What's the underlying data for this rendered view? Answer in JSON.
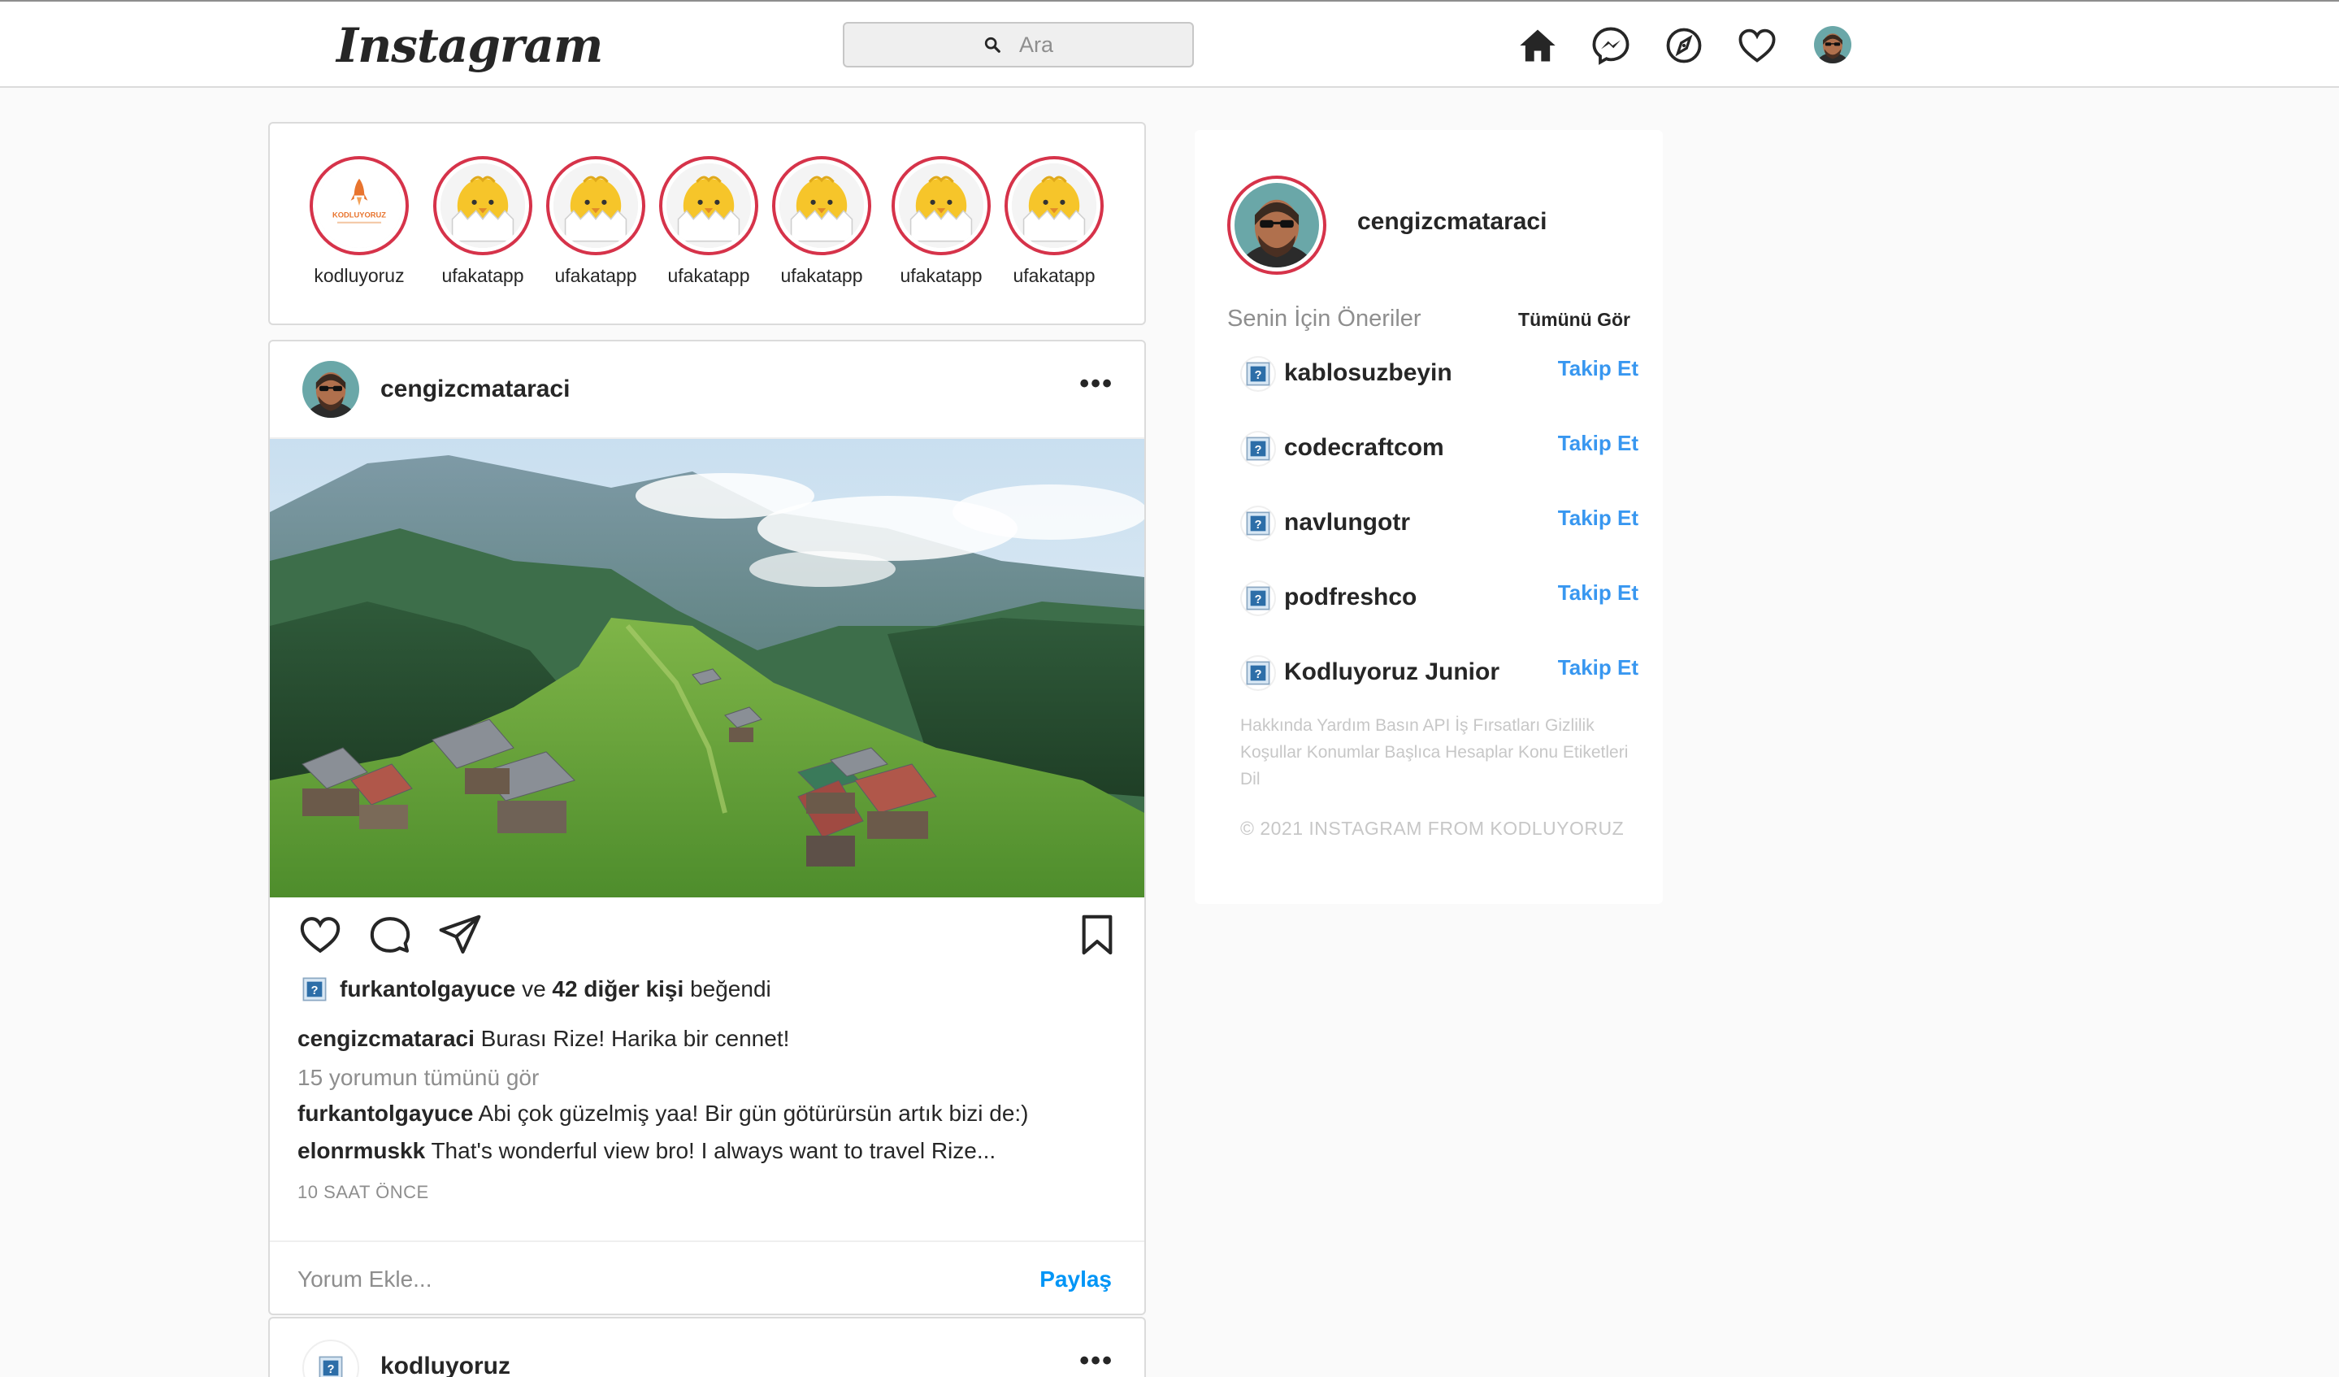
{
  "navbar": {
    "logo_text": "Instagram",
    "search_placeholder": "Ara",
    "icons": [
      "home-icon",
      "messenger-icon",
      "explore-icon",
      "heart-icon",
      "profile-avatar"
    ]
  },
  "stories": [
    {
      "name": "kodluyoruz"
    },
    {
      "name": "ufakatapp"
    },
    {
      "name": "ufakatapp"
    },
    {
      "name": "ufakatapp"
    },
    {
      "name": "ufakatapp"
    },
    {
      "name": "ufakatapp"
    },
    {
      "name": "ufakatapp"
    }
  ],
  "post": {
    "username": "cengizcmataraci",
    "more_label": "•••",
    "likes": {
      "liker": "furkantolgayuce",
      "connector": "ve",
      "others": "42 diğer kişi",
      "suffix": "beğendi"
    },
    "caption": {
      "user": "cengizcmataraci",
      "text": "Burası Rize! Harika bir cennet!"
    },
    "view_all_comments": "15 yorumun tümünü gör",
    "comments": [
      {
        "user": "furkantolgayuce",
        "text": "Abi çok güzelmiş yaa! Bir gün götürürsün artık bizi de:)"
      },
      {
        "user": "elonrmuskk",
        "text": "That's wonderful view bro! I always want to travel Rize..."
      }
    ],
    "time": "10 SAAT ÖNCE",
    "add_comment_placeholder": "Yorum Ekle...",
    "share_label": "Paylaş"
  },
  "post2": {
    "username": "kodluyoruz",
    "more_label": "•••"
  },
  "sidebar": {
    "username": "cengizcmataraci",
    "suggestions_title": "Senin İçin Öneriler",
    "see_all": "Tümünü Gör",
    "suggestions": [
      {
        "name": "kablosuzbeyin",
        "action": "Takip Et"
      },
      {
        "name": "codecraftcom",
        "action": "Takip Et"
      },
      {
        "name": "navlungotr",
        "action": "Takip Et"
      },
      {
        "name": "podfreshco",
        "action": "Takip Et"
      },
      {
        "name": "Kodluyoruz Junior",
        "action": "Takip Et"
      }
    ],
    "footer_links": "Hakkında Yardım Basın API İş Fırsatları Gizlilik Koşullar Konumlar Başlıca Hesaplar Konu Etiketleri Dil",
    "copyright": "© 2021 INSTAGRAM FROM KODLUYORUZ"
  },
  "colors": {
    "accent": "#0095f6",
    "follow": "#3897f0",
    "story_ring": "#d6334a",
    "muted": "#8e8e8e",
    "border": "#dbdbdb"
  }
}
